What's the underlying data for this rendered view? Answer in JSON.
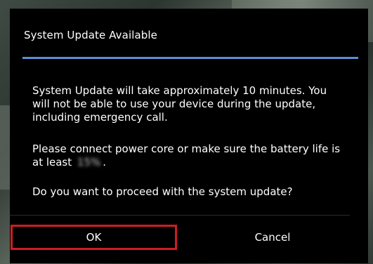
{
  "dialog": {
    "title": "System Update Available",
    "message_paragraph_1": "System Update will take approximately 10 minutes. You will not be able to use your device during the update, including emergency call.",
    "message_paragraph_2_prefix": "Please connect power core or make sure the battery life is at least",
    "battery_threshold": "15%",
    "message_paragraph_2_suffix": ".",
    "message_paragraph_3": "Do you want to proceed with the system update?",
    "ok_label": "OK",
    "cancel_label": "Cancel"
  },
  "colors": {
    "dialog_background": "#000000",
    "title_divider": "#5b8fd8",
    "ok_highlight_border": "#d01c22",
    "text": "#ffffff"
  }
}
